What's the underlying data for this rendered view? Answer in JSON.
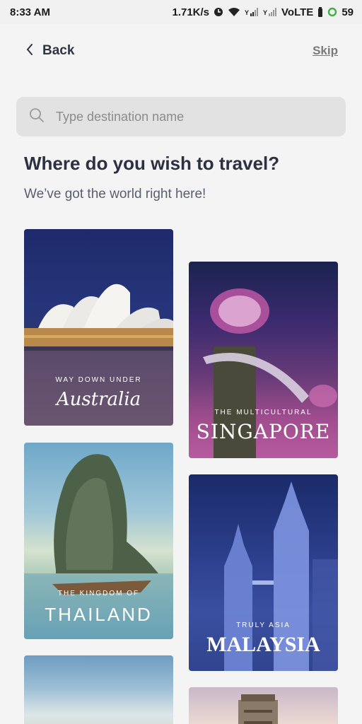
{
  "status_bar": {
    "time": "8:33 AM",
    "speed": "1.71K/s",
    "network": "VoLTE",
    "battery": "59"
  },
  "nav": {
    "back_label": "Back",
    "skip_label": "Skip"
  },
  "search": {
    "placeholder": "Type destination name",
    "value": ""
  },
  "header": {
    "title": "Where do you wish to travel?",
    "subtitle": "We’ve got the world right here!"
  },
  "destinations": [
    {
      "kicker": "WAY DOWN UNDER",
      "name": "Australia"
    },
    {
      "kicker": "THE MULTICULTURAL",
      "name": "SINGAPORE"
    },
    {
      "kicker": "THE KINGDOM OF",
      "name": "THAILAND"
    },
    {
      "kicker": "TRULY ASIA",
      "name": "MALAYSIA"
    }
  ],
  "colors": {
    "title": "#2d3042",
    "search_bg": "#e2e2e2",
    "page_bg": "#f4f4f4"
  }
}
